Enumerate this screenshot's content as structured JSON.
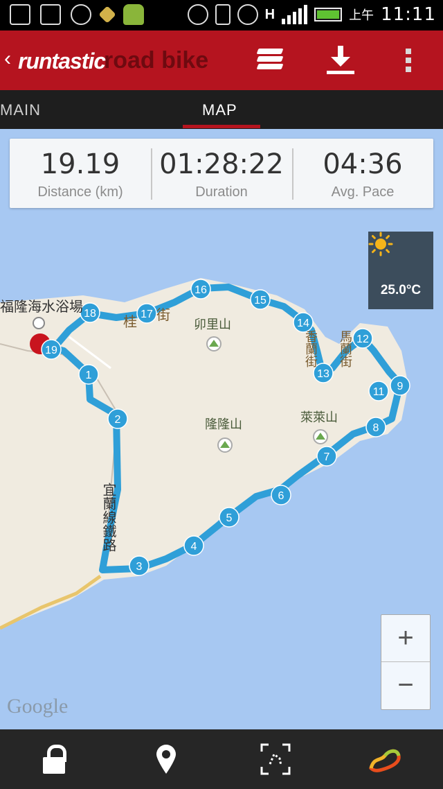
{
  "status_bar": {
    "ampm": "上午",
    "time": "11:11",
    "network_letter": "H"
  },
  "app_bar": {
    "brand": "runtastic",
    "subtitle": "road bike"
  },
  "tabs": {
    "main": "MAIN",
    "map": "MAP"
  },
  "stats": [
    {
      "value": "19.19",
      "label": "Distance (km)"
    },
    {
      "value": "01:28:22",
      "label": "Duration"
    },
    {
      "value": "04:36",
      "label": "Avg. Pace"
    }
  ],
  "weather": {
    "temperature": "25.0°C",
    "icon": "sun-icon"
  },
  "map": {
    "labels": {
      "beach": "福隆海水浴場",
      "mountain1": "卯里山",
      "mountain2": "隆隆山",
      "mountain3": "萊萊山",
      "rail": "宜蘭線鐵路",
      "street1": "桂",
      "street2": "街",
      "street3": "香蘭街",
      "street4": "馬蘭街"
    },
    "markers": [
      "1",
      "2",
      "3",
      "4",
      "5",
      "6",
      "7",
      "8",
      "9",
      "11",
      "12",
      "13",
      "14",
      "15",
      "16",
      "17",
      "18",
      "19"
    ],
    "google": "Google"
  },
  "zoom": {
    "in": "+",
    "out": "−"
  },
  "colors": {
    "accent": "#b5141f",
    "route": "#2f9fd8",
    "land": "#f0ebe0",
    "water": "#a7c8f2"
  }
}
